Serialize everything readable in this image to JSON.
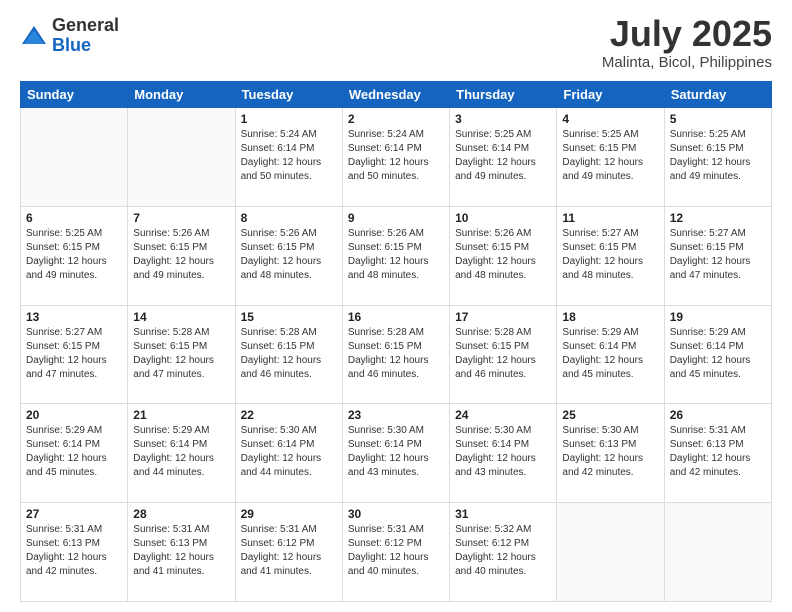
{
  "header": {
    "logo_general": "General",
    "logo_blue": "Blue",
    "title": "July 2025",
    "location": "Malinta, Bicol, Philippines"
  },
  "days_of_week": [
    "Sunday",
    "Monday",
    "Tuesday",
    "Wednesday",
    "Thursday",
    "Friday",
    "Saturday"
  ],
  "weeks": [
    [
      {
        "day": "",
        "sunrise": "",
        "sunset": "",
        "daylight": "",
        "empty": true
      },
      {
        "day": "",
        "sunrise": "",
        "sunset": "",
        "daylight": "",
        "empty": true
      },
      {
        "day": "1",
        "sunrise": "Sunrise: 5:24 AM",
        "sunset": "Sunset: 6:14 PM",
        "daylight": "Daylight: 12 hours and 50 minutes."
      },
      {
        "day": "2",
        "sunrise": "Sunrise: 5:24 AM",
        "sunset": "Sunset: 6:14 PM",
        "daylight": "Daylight: 12 hours and 50 minutes."
      },
      {
        "day": "3",
        "sunrise": "Sunrise: 5:25 AM",
        "sunset": "Sunset: 6:14 PM",
        "daylight": "Daylight: 12 hours and 49 minutes."
      },
      {
        "day": "4",
        "sunrise": "Sunrise: 5:25 AM",
        "sunset": "Sunset: 6:15 PM",
        "daylight": "Daylight: 12 hours and 49 minutes."
      },
      {
        "day": "5",
        "sunrise": "Sunrise: 5:25 AM",
        "sunset": "Sunset: 6:15 PM",
        "daylight": "Daylight: 12 hours and 49 minutes."
      }
    ],
    [
      {
        "day": "6",
        "sunrise": "Sunrise: 5:25 AM",
        "sunset": "Sunset: 6:15 PM",
        "daylight": "Daylight: 12 hours and 49 minutes."
      },
      {
        "day": "7",
        "sunrise": "Sunrise: 5:26 AM",
        "sunset": "Sunset: 6:15 PM",
        "daylight": "Daylight: 12 hours and 49 minutes."
      },
      {
        "day": "8",
        "sunrise": "Sunrise: 5:26 AM",
        "sunset": "Sunset: 6:15 PM",
        "daylight": "Daylight: 12 hours and 48 minutes."
      },
      {
        "day": "9",
        "sunrise": "Sunrise: 5:26 AM",
        "sunset": "Sunset: 6:15 PM",
        "daylight": "Daylight: 12 hours and 48 minutes."
      },
      {
        "day": "10",
        "sunrise": "Sunrise: 5:26 AM",
        "sunset": "Sunset: 6:15 PM",
        "daylight": "Daylight: 12 hours and 48 minutes."
      },
      {
        "day": "11",
        "sunrise": "Sunrise: 5:27 AM",
        "sunset": "Sunset: 6:15 PM",
        "daylight": "Daylight: 12 hours and 48 minutes."
      },
      {
        "day": "12",
        "sunrise": "Sunrise: 5:27 AM",
        "sunset": "Sunset: 6:15 PM",
        "daylight": "Daylight: 12 hours and 47 minutes."
      }
    ],
    [
      {
        "day": "13",
        "sunrise": "Sunrise: 5:27 AM",
        "sunset": "Sunset: 6:15 PM",
        "daylight": "Daylight: 12 hours and 47 minutes."
      },
      {
        "day": "14",
        "sunrise": "Sunrise: 5:28 AM",
        "sunset": "Sunset: 6:15 PM",
        "daylight": "Daylight: 12 hours and 47 minutes."
      },
      {
        "day": "15",
        "sunrise": "Sunrise: 5:28 AM",
        "sunset": "Sunset: 6:15 PM",
        "daylight": "Daylight: 12 hours and 46 minutes."
      },
      {
        "day": "16",
        "sunrise": "Sunrise: 5:28 AM",
        "sunset": "Sunset: 6:15 PM",
        "daylight": "Daylight: 12 hours and 46 minutes."
      },
      {
        "day": "17",
        "sunrise": "Sunrise: 5:28 AM",
        "sunset": "Sunset: 6:15 PM",
        "daylight": "Daylight: 12 hours and 46 minutes."
      },
      {
        "day": "18",
        "sunrise": "Sunrise: 5:29 AM",
        "sunset": "Sunset: 6:14 PM",
        "daylight": "Daylight: 12 hours and 45 minutes."
      },
      {
        "day": "19",
        "sunrise": "Sunrise: 5:29 AM",
        "sunset": "Sunset: 6:14 PM",
        "daylight": "Daylight: 12 hours and 45 minutes."
      }
    ],
    [
      {
        "day": "20",
        "sunrise": "Sunrise: 5:29 AM",
        "sunset": "Sunset: 6:14 PM",
        "daylight": "Daylight: 12 hours and 45 minutes."
      },
      {
        "day": "21",
        "sunrise": "Sunrise: 5:29 AM",
        "sunset": "Sunset: 6:14 PM",
        "daylight": "Daylight: 12 hours and 44 minutes."
      },
      {
        "day": "22",
        "sunrise": "Sunrise: 5:30 AM",
        "sunset": "Sunset: 6:14 PM",
        "daylight": "Daylight: 12 hours and 44 minutes."
      },
      {
        "day": "23",
        "sunrise": "Sunrise: 5:30 AM",
        "sunset": "Sunset: 6:14 PM",
        "daylight": "Daylight: 12 hours and 43 minutes."
      },
      {
        "day": "24",
        "sunrise": "Sunrise: 5:30 AM",
        "sunset": "Sunset: 6:14 PM",
        "daylight": "Daylight: 12 hours and 43 minutes."
      },
      {
        "day": "25",
        "sunrise": "Sunrise: 5:30 AM",
        "sunset": "Sunset: 6:13 PM",
        "daylight": "Daylight: 12 hours and 42 minutes."
      },
      {
        "day": "26",
        "sunrise": "Sunrise: 5:31 AM",
        "sunset": "Sunset: 6:13 PM",
        "daylight": "Daylight: 12 hours and 42 minutes."
      }
    ],
    [
      {
        "day": "27",
        "sunrise": "Sunrise: 5:31 AM",
        "sunset": "Sunset: 6:13 PM",
        "daylight": "Daylight: 12 hours and 42 minutes."
      },
      {
        "day": "28",
        "sunrise": "Sunrise: 5:31 AM",
        "sunset": "Sunset: 6:13 PM",
        "daylight": "Daylight: 12 hours and 41 minutes."
      },
      {
        "day": "29",
        "sunrise": "Sunrise: 5:31 AM",
        "sunset": "Sunset: 6:12 PM",
        "daylight": "Daylight: 12 hours and 41 minutes."
      },
      {
        "day": "30",
        "sunrise": "Sunrise: 5:31 AM",
        "sunset": "Sunset: 6:12 PM",
        "daylight": "Daylight: 12 hours and 40 minutes."
      },
      {
        "day": "31",
        "sunrise": "Sunrise: 5:32 AM",
        "sunset": "Sunset: 6:12 PM",
        "daylight": "Daylight: 12 hours and 40 minutes."
      },
      {
        "day": "",
        "sunrise": "",
        "sunset": "",
        "daylight": "",
        "empty": true
      },
      {
        "day": "",
        "sunrise": "",
        "sunset": "",
        "daylight": "",
        "empty": true
      }
    ]
  ]
}
